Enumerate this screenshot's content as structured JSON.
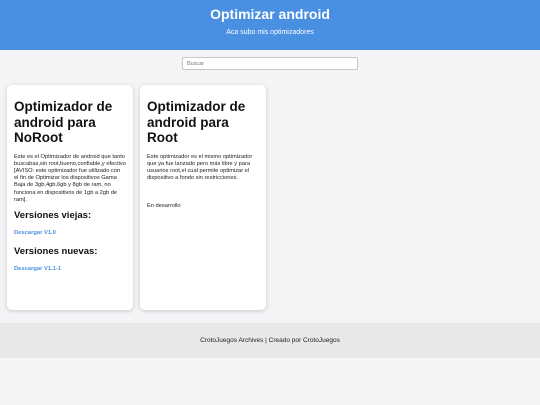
{
  "header": {
    "title": "Optimizar android",
    "subtitle": "Aca subo mis optimizadores"
  },
  "search": {
    "placeholder": "Buscar",
    "value": ""
  },
  "cards": [
    {
      "title": "Optimizador de android para NoRoot",
      "description": "Este es el Optimizador de android que tanto buscabas,sin root,bueno,confiable,y efectivo [AVISO: este optimizador fue utilizado con el fin de Optimizar los dispositivos Gama Baja de 3gb,4gb,6gb y 8gb de ram, no funciona en dispositivos de 1gb a 2gb de ram].",
      "old_versions_heading": "Versiones viejas:",
      "old_download": "Descargar V1.0",
      "new_versions_heading": "Versiones nuevas:",
      "new_download": "Descargar V1.1-1"
    },
    {
      "title": "Optimizador de android para Root",
      "description": "Este optimizador es el mismo optimizador que ya fue lanzado pero más libre y para usuarios root,el cual permite optimizar el dispositivo a fondo sin restricciones.",
      "status": "En desarrollo"
    }
  ],
  "footer": {
    "text": "CrotoJuegos Archives | Creado por CrotoJuegos"
  },
  "colors": {
    "accent": "#4a90e2",
    "background": "#f4f4f7",
    "footer_bg": "#e8e8eb"
  }
}
